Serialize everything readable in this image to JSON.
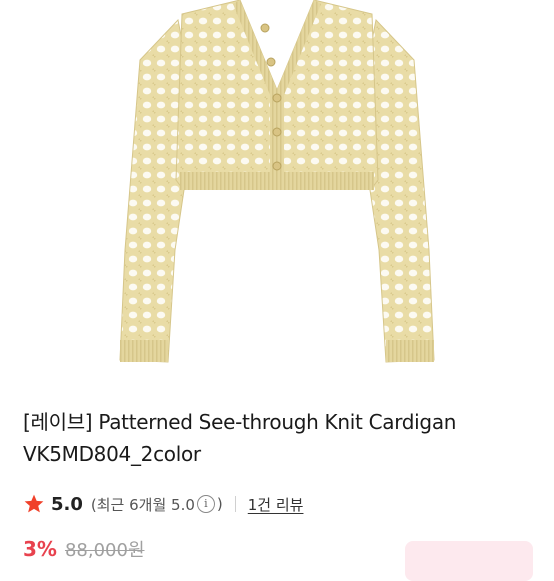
{
  "product": {
    "title": "[레이브] Patterned See-through Knit Cardigan VK5MD804_2color",
    "image_alt": "Patterned see-through knit cardigan in cream",
    "image_color": "#ede0ae"
  },
  "rating": {
    "score": "5.0",
    "recent_note_prefix": "(최근 6개월 5.0",
    "recent_note_suffix": ")",
    "info_icon": "i",
    "review_link": "1건 리뷰",
    "star_color": "#f0412a"
  },
  "price": {
    "discount": "3%",
    "original": "88,000원"
  }
}
